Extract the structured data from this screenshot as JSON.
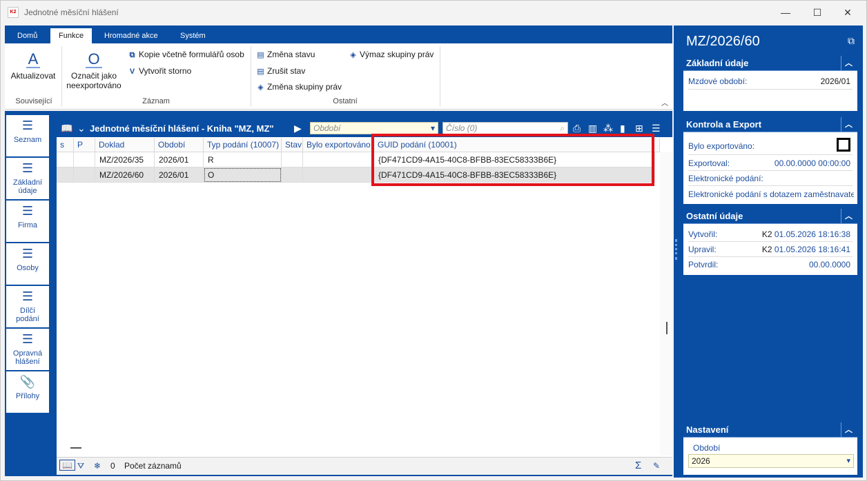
{
  "window": {
    "app_icon_text": "K2",
    "title": "Jednotné měsíční hlášení",
    "minimize": "—",
    "maximize": "☐",
    "close": "✕"
  },
  "ribbon": {
    "tabs": [
      "Domů",
      "Funkce",
      "Hromadné akce",
      "Systém"
    ],
    "active_tab": "Funkce",
    "groups": {
      "souvisejici": {
        "label": "Související",
        "aktualizovat_glyph": "A",
        "aktualizovat_label": "Aktualizovat"
      },
      "zaznam": {
        "label": "Záznam",
        "oznacit_glyph": "O",
        "oznacit_label_1": "Označit jako",
        "oznacit_label_2": "neexportováno",
        "kopie_label": "Kopie včetně formulářů osob",
        "storno_glyph": "V",
        "storno_label": "Vytvořit storno"
      },
      "ostatni": {
        "label": "Ostatní",
        "zmena_stavu": "Změna stavu",
        "zrusit_stav": "Zrušit stav",
        "zmena_skupiny": "Změna skupiny práv",
        "vymaz_skupiny": "Výmaz skupiny práv"
      }
    }
  },
  "nav": [
    {
      "label": "Seznam"
    },
    {
      "label_1": "Základní",
      "label_2": "údaje"
    },
    {
      "label": "Firma"
    },
    {
      "label": "Osoby"
    },
    {
      "label_1": "Dílčí",
      "label_2": "podání"
    },
    {
      "label_1": "Opravná",
      "label_2": "hlášení"
    },
    {
      "label": "Přílohy"
    }
  ],
  "grid": {
    "title": "Jednotné měsíční hlášení - Kniha \"MZ, MZ\"",
    "filter_obdobi_placeholder": "Období",
    "filter_cislo_placeholder": "Číslo (0)",
    "columns": [
      "s",
      "P",
      "Doklad",
      "Období",
      "Typ podání (10007)",
      "Stav",
      "Bylo exportováno",
      "GUID podání (10001)"
    ],
    "rows": [
      {
        "s": "",
        "p": "",
        "doklad": "MZ/2026/35",
        "obdobi": "2026/01",
        "typ": "R",
        "stav": "",
        "exportovano": "",
        "guid": "{DF471CD9-4A15-40C8-BFBB-83EC58333B6E}"
      },
      {
        "s": "",
        "p": "",
        "doklad": "MZ/2026/60",
        "obdobi": "2026/01",
        "typ": "O",
        "stav": "",
        "exportovano": "",
        "guid": "{DF471CD9-4A15-40C8-BFBB-83EC58333B6E}"
      }
    ],
    "selected_row": 1,
    "footer": {
      "count": "0",
      "count_label": "Počet záznamů"
    }
  },
  "right_panel": {
    "title": "MZ/2026/60",
    "zakladni": {
      "header": "Základní údaje",
      "mzdove_obdobi_label": "Mzdové období:",
      "mzdove_obdobi_value": "2026/01"
    },
    "kontrola": {
      "header": "Kontrola a Export",
      "bylo_exportovano_label": "Bylo exportováno:",
      "bylo_exportovano_checked": false,
      "exportoval_label": "Exportoval:",
      "exportoval_value": "00.00.0000 00:00:00",
      "elektronicke_podani_label": "Elektronické podání:",
      "elektronicke_dotaz_label": "Elektronické podání s dotazem zaměstnavatele"
    },
    "ostatni": {
      "header": "Ostatní údaje",
      "vytvoril_label": "Vytvořil:",
      "vytvoril_user": "K2",
      "vytvoril_value": "01.05.2026 18:16:38",
      "upravil_label": "Upravil:",
      "upravil_user": "K2",
      "upravil_value": "01.05.2026 18:16:41",
      "potvrdil_label": "Potvrdil:",
      "potvrdil_value": "00.00.0000"
    },
    "nastaveni": {
      "header": "Nastavení",
      "obdobi_label": "Období",
      "obdobi_value": "2026"
    }
  },
  "colors": {
    "accent": "#0a4ea3",
    "highlight_box": "#e0141c",
    "link_text": "#1d4e9e"
  }
}
